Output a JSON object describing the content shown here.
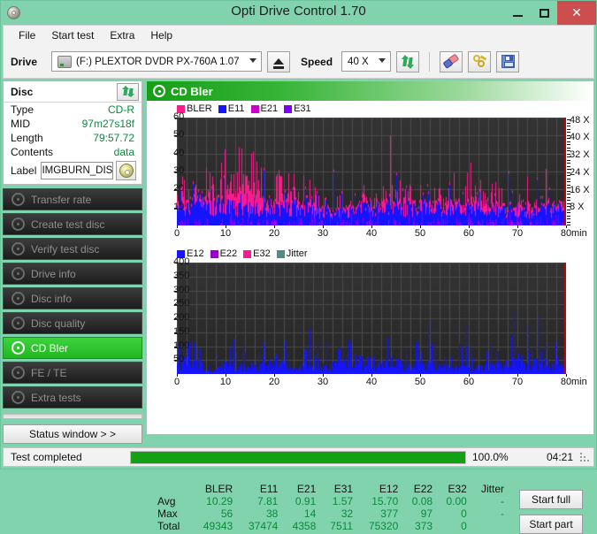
{
  "window": {
    "title": "Opti Drive Control 1.70",
    "app_icon": "disc-icon",
    "minimize": "–",
    "maximize": "□",
    "close": "✕"
  },
  "menu": {
    "items": [
      {
        "label": "File"
      },
      {
        "label": "Start test"
      },
      {
        "label": "Extra"
      },
      {
        "label": "Help"
      }
    ]
  },
  "toolbar": {
    "drive_label": "Drive",
    "drive_value": "(F:)   PLEXTOR DVDR   PX-760A 1.07",
    "eject_icon": "eject-icon",
    "speed_label": "Speed",
    "speed_value": "40 X",
    "refresh_icon": "refresh-icon",
    "erase_icon": "eraser-icon",
    "tools_icon": "tools-icon",
    "save_icon": "save-icon"
  },
  "disc_panel": {
    "title": "Disc",
    "refresh_icon": "refresh-icon",
    "rows": [
      {
        "key": "Type",
        "value": "CD-R"
      },
      {
        "key": "MID",
        "value": "97m27s18f"
      },
      {
        "key": "Length",
        "value": "79:57.72"
      },
      {
        "key": "Contents",
        "value": "data"
      }
    ],
    "label_key": "Label",
    "label_value": "IMGBURN_DIS",
    "cd_icon": "cd-icon"
  },
  "nav": {
    "items": [
      {
        "label": "Transfer rate",
        "icon": "disc-icon",
        "active": false
      },
      {
        "label": "Create test disc",
        "icon": "disc-icon",
        "active": false
      },
      {
        "label": "Verify test disc",
        "icon": "disc-icon",
        "active": false
      },
      {
        "label": "Drive info",
        "icon": "disc-icon",
        "active": false
      },
      {
        "label": "Disc info",
        "icon": "disc-icon",
        "active": false
      },
      {
        "label": "Disc quality",
        "icon": "disc-icon",
        "active": false
      },
      {
        "label": "CD Bler",
        "icon": "disc-icon",
        "active": true
      },
      {
        "label": "FE / TE",
        "icon": "disc-icon",
        "active": false
      },
      {
        "label": "Extra tests",
        "icon": "disc-icon",
        "active": false
      }
    ],
    "status_window": "Status window > >"
  },
  "panel": {
    "title": "CD Bler",
    "icon": "disc-icon"
  },
  "actions": {
    "start_full": "Start full",
    "start_part": "Start part"
  },
  "statusbar": {
    "text": "Test completed",
    "progress_pct": "100.0%",
    "progress_value": 100,
    "elapsed": "04:21"
  },
  "stats": {
    "columns": [
      "BLER",
      "E11",
      "E21",
      "E31",
      "E12",
      "E22",
      "E32",
      "Jitter"
    ],
    "rows": [
      {
        "name": "Avg",
        "values": [
          "10.29",
          "7.81",
          "0.91",
          "1.57",
          "15.70",
          "0.08",
          "0.00",
          "-"
        ]
      },
      {
        "name": "Max",
        "values": [
          "56",
          "38",
          "14",
          "32",
          "377",
          "97",
          "0",
          "-"
        ]
      },
      {
        "name": "Total",
        "values": [
          "49343",
          "37474",
          "4358",
          "7511",
          "75320",
          "373",
          "0",
          ""
        ]
      }
    ]
  },
  "chart_data": [
    {
      "type": "area",
      "id": "chart-bler",
      "title": "CD Bler",
      "xlabel": "min",
      "ylabel": "",
      "xlim": [
        0,
        80
      ],
      "ylim": [
        0,
        60
      ],
      "xticks": [
        0,
        10,
        20,
        30,
        40,
        50,
        60,
        70,
        80
      ],
      "yticks": [
        10,
        20,
        30,
        40,
        50,
        60
      ],
      "y2label": "X",
      "y2ticks": [
        "8 X",
        "16 X",
        "24 X",
        "32 X",
        "40 X",
        "48 X"
      ],
      "y2lim": [
        0,
        56
      ],
      "grid": true,
      "legend_position": "top-left",
      "legend": [
        {
          "name": "BLER",
          "color": "#ff1a8c"
        },
        {
          "name": "E11",
          "color": "#1414ff"
        },
        {
          "name": "E21",
          "color": "#cc00cc"
        },
        {
          "name": "E31",
          "color": "#8000ff"
        }
      ],
      "series": [
        {
          "name": "BLER",
          "color": "#ff1a8c",
          "avg": 10.29,
          "max": 56,
          "total": 49343
        },
        {
          "name": "E11",
          "color": "#1414ff",
          "avg": 7.81,
          "max": 38,
          "total": 37474
        },
        {
          "name": "E21",
          "color": "#cc00cc",
          "avg": 0.91,
          "max": 14,
          "total": 4358
        },
        {
          "name": "E31",
          "color": "#8000ff",
          "avg": 1.57,
          "max": 32,
          "total": 7511
        }
      ]
    },
    {
      "type": "area",
      "id": "chart-e12",
      "title": "",
      "xlabel": "min",
      "ylabel": "",
      "xlim": [
        0,
        80
      ],
      "ylim": [
        0,
        400
      ],
      "xticks": [
        0,
        10,
        20,
        30,
        40,
        50,
        60,
        70,
        80
      ],
      "yticks": [
        50,
        100,
        150,
        200,
        250,
        300,
        350,
        400
      ],
      "grid": true,
      "legend_position": "top-left",
      "legend": [
        {
          "name": "E12",
          "color": "#1414ff"
        },
        {
          "name": "E22",
          "color": "#9900cc"
        },
        {
          "name": "E32",
          "color": "#ff1a8c"
        },
        {
          "name": "Jitter",
          "color": "#4e8c86"
        }
      ],
      "series": [
        {
          "name": "E12",
          "color": "#1414ff",
          "avg": 15.7,
          "max": 377,
          "total": 75320
        },
        {
          "name": "E22",
          "color": "#9900cc",
          "avg": 0.08,
          "max": 97,
          "total": 373
        },
        {
          "name": "E32",
          "color": "#ff1a8c",
          "avg": 0.0,
          "max": 0,
          "total": 0
        },
        {
          "name": "Jitter",
          "color": "#4e8c86",
          "avg": null,
          "max": null,
          "total": null
        }
      ]
    }
  ]
}
